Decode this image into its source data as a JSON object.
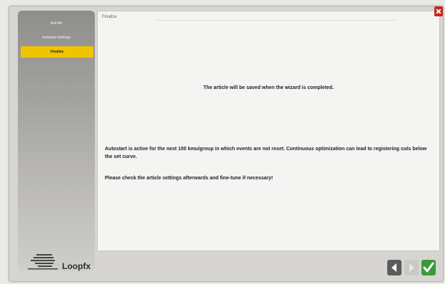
{
  "sidebar": {
    "steps": [
      {
        "label": "Add file"
      },
      {
        "label": "Autostart Settings"
      },
      {
        "label": "Finalize"
      }
    ],
    "logo_text": "Loopfx"
  },
  "panel": {
    "title": "Finalize",
    "message_primary": "The article will be saved when the wizard is completed.",
    "message_autostart": "Autostart is active for the next 100 kmu/group in which events are not reset. Continuous optimization can lead to registering cuts below the set curve.",
    "message_check": "Please check the article settings afterwards and fine-tune if necessary!"
  },
  "icons": {
    "close": "close-icon",
    "back": "arrow-left-icon",
    "next": "arrow-right-icon",
    "confirm": "checkmark-icon"
  },
  "colors": {
    "active_step": "#f1c400",
    "close": "#c8261d",
    "confirm": "#3c9a36"
  }
}
